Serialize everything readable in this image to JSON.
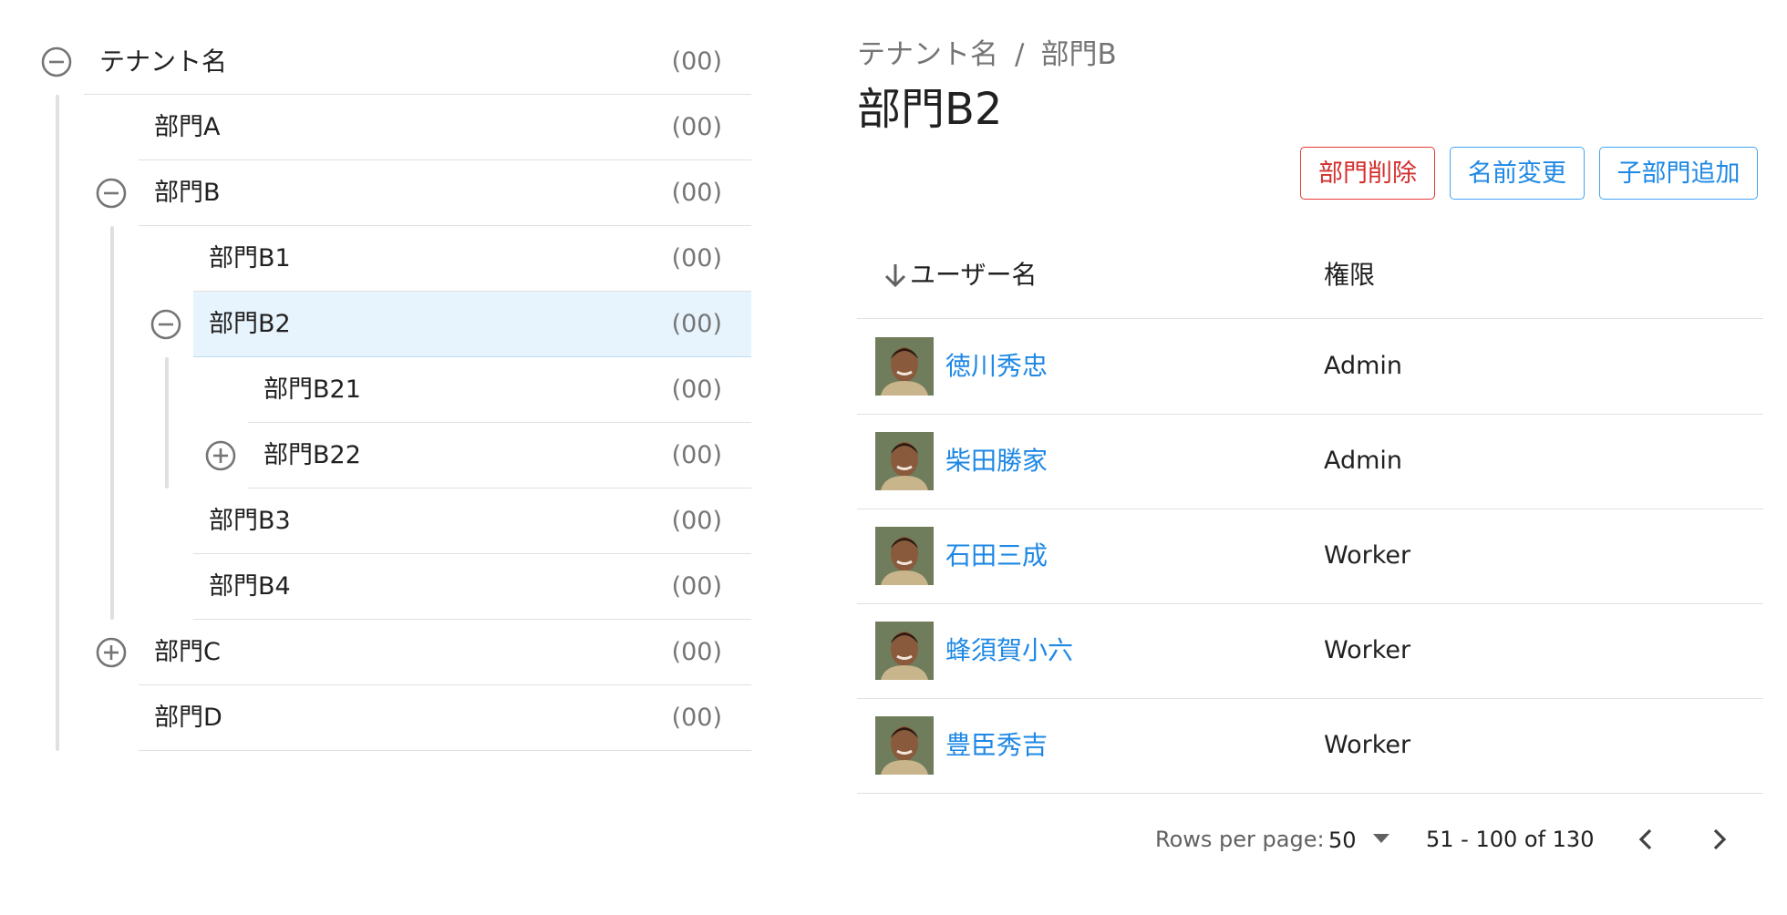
{
  "tree": {
    "nodes": [
      {
        "label": "テナント名",
        "count": "(00)",
        "toggle": "minus"
      },
      {
        "label": "部門A",
        "count": "(00)"
      },
      {
        "label": "部門B",
        "count": "(00)",
        "toggle": "minus"
      },
      {
        "label": "部門B1",
        "count": "(00)"
      },
      {
        "label": "部門B2",
        "count": "(00)",
        "toggle": "minus",
        "selected": true
      },
      {
        "label": "部門B21",
        "count": "(00)"
      },
      {
        "label": "部門B22",
        "count": "(00)",
        "toggle": "plus"
      },
      {
        "label": "部門B3",
        "count": "(00)"
      },
      {
        "label": "部門B4",
        "count": "(00)"
      },
      {
        "label": "部門C",
        "count": "(00)",
        "toggle": "plus"
      },
      {
        "label": "部門D",
        "count": "(00)"
      }
    ]
  },
  "breadcrumb": {
    "items": [
      "テナント名",
      "部門B"
    ],
    "separator": "/"
  },
  "page": {
    "title": "部門B2"
  },
  "actions": {
    "delete_label": "部門削除",
    "rename_label": "名前変更",
    "add_child_label": "子部門追加"
  },
  "table": {
    "headers": {
      "username": "ユーザー名",
      "role": "権限"
    },
    "rows": [
      {
        "name": "徳川秀忠",
        "role": "Admin"
      },
      {
        "name": "柴田勝家",
        "role": "Admin"
      },
      {
        "name": "石田三成",
        "role": "Worker"
      },
      {
        "name": "蜂須賀小六",
        "role": "Worker"
      },
      {
        "name": "豊臣秀吉",
        "role": "Worker"
      }
    ]
  },
  "pagination": {
    "rows_per_page_label": "Rows per page:",
    "rows_per_page": "50",
    "range": "51 - 100 of 130"
  },
  "colors": {
    "accent": "#1e88e5",
    "danger": "#d32f2f",
    "selected_row": "#e8f4fd"
  }
}
